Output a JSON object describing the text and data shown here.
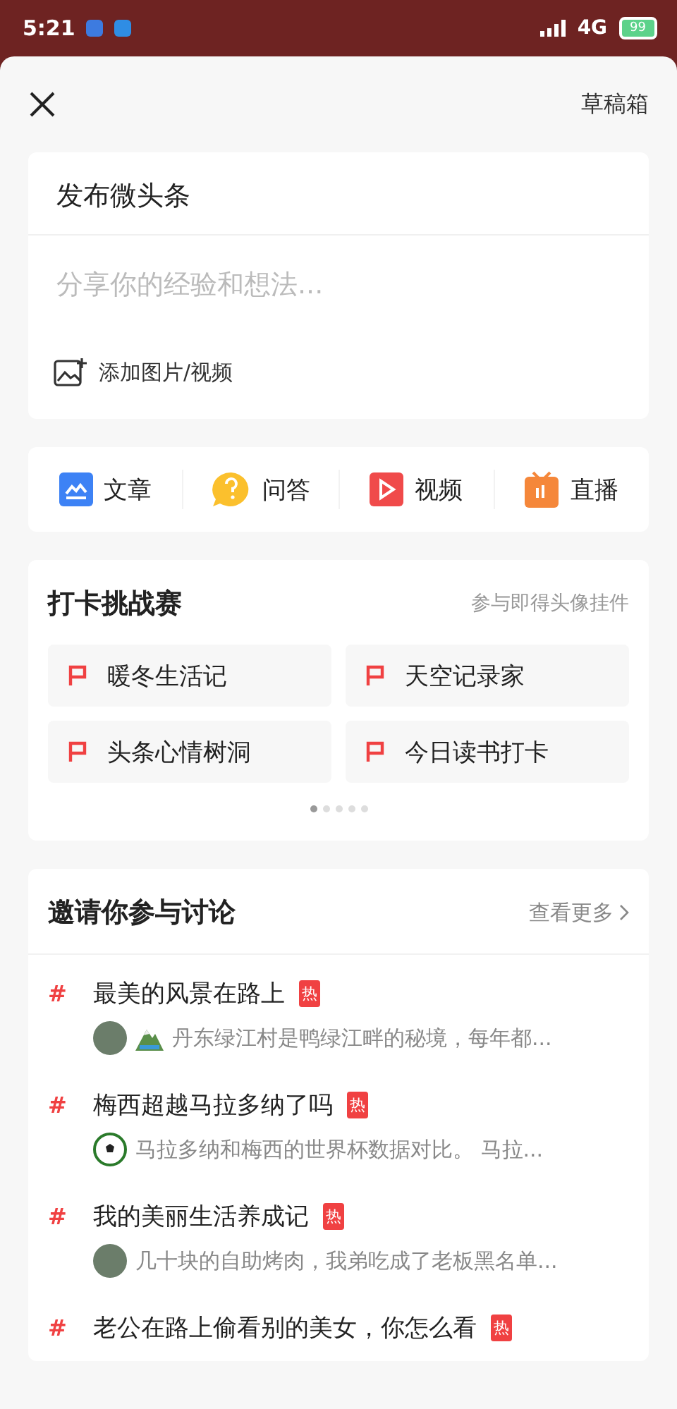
{
  "status_bar": {
    "time": "5:21",
    "network": "4G",
    "battery": "99"
  },
  "header": {
    "drafts": "草稿箱"
  },
  "composer": {
    "title": "发布微头条",
    "placeholder": "分享你的经验和想法...",
    "media_label": "添加图片/视频"
  },
  "post_types": [
    {
      "kind": "article",
      "label": "文章"
    },
    {
      "kind": "qa",
      "label": "问答"
    },
    {
      "kind": "video",
      "label": "视频"
    },
    {
      "kind": "live",
      "label": "直播"
    }
  ],
  "challenges": {
    "title": "打卡挑战赛",
    "hint": "参与即得头像挂件",
    "items": [
      "暖冬生活记",
      "天空记录家",
      "头条心情树洞",
      "今日读书打卡"
    ],
    "dots": [
      {
        "selected": true
      },
      {
        "selected": false
      },
      {
        "selected": false
      },
      {
        "selected": false
      },
      {
        "selected": false
      }
    ]
  },
  "discussions": {
    "title": "邀请你参与讨论",
    "more": "查看更多",
    "topics": [
      {
        "marker": "#",
        "title": "最美的风景在路上",
        "badge": "热",
        "kind": "photo",
        "emoji": true,
        "excerpt": "丹东绿江村是鸭绿江畔的秘境，每年都..."
      },
      {
        "marker": "#",
        "title": "梅西超越马拉多纳了吗",
        "badge": "热",
        "kind": "ball",
        "emoji": false,
        "excerpt": "马拉多纳和梅西的世界杯数据对比。 马拉..."
      },
      {
        "marker": "#",
        "title": "我的美丽生活养成记",
        "badge": "热",
        "kind": "photo",
        "emoji": false,
        "excerpt": "几十块的自助烤肉，我弟吃成了老板黑名单..."
      },
      {
        "marker": "#",
        "title": "老公在路上偷看别的美女，你怎么看",
        "badge": "热"
      }
    ]
  }
}
